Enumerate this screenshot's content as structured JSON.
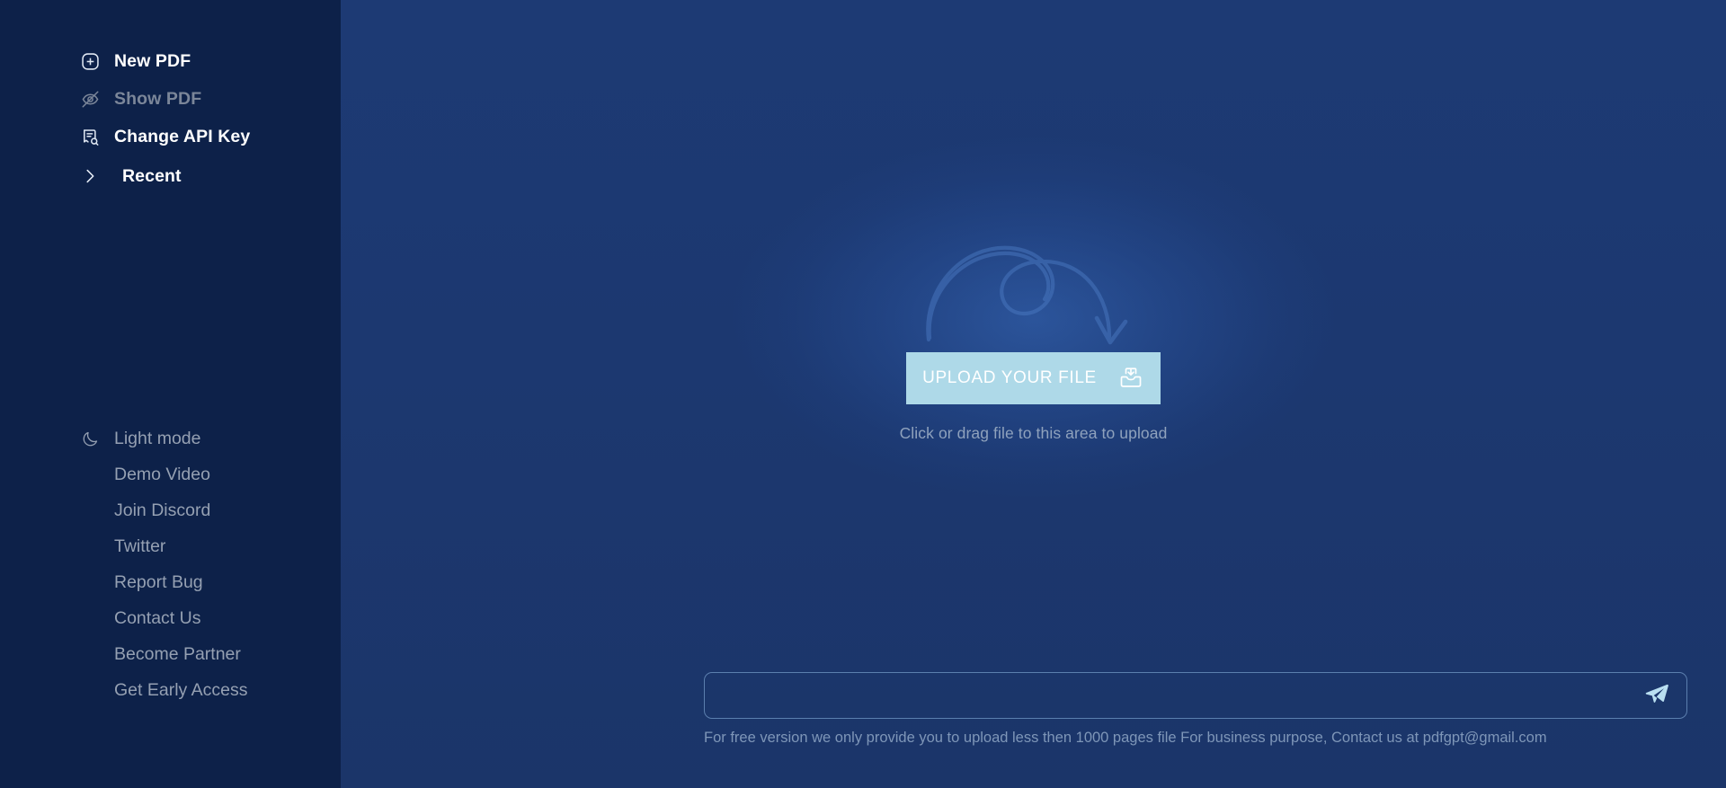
{
  "app": {
    "accent_button_bg": "#aed9e8",
    "sidebar_bg": "#0d2149",
    "main_bg": "#1c3870",
    "muted_text": "#95a0b2"
  },
  "sidebar": {
    "primary_items": [
      {
        "label": "New PDF",
        "icon": "plus-square-icon",
        "state": "active"
      },
      {
        "label": "Show PDF",
        "icon": "eye-off-icon",
        "state": "disabled"
      },
      {
        "label": "Change API Key",
        "icon": "document-search-icon",
        "state": "active"
      },
      {
        "label": "Recent",
        "icon": "chevron-right-icon",
        "state": "active"
      }
    ],
    "secondary_items": [
      {
        "label": "Light mode",
        "icon": "moon-icon"
      },
      {
        "label": "Demo Video",
        "icon": ""
      },
      {
        "label": "Join Discord",
        "icon": ""
      },
      {
        "label": "Twitter",
        "icon": ""
      },
      {
        "label": "Report Bug",
        "icon": ""
      },
      {
        "label": "Contact Us",
        "icon": ""
      },
      {
        "label": "Become Partner",
        "icon": ""
      },
      {
        "label": "Get Early Access",
        "icon": ""
      }
    ]
  },
  "main": {
    "dropzone": {
      "upload_button_label": "UPLOAD YOUR FILE",
      "upload_button_icon": "inbox-download-icon",
      "hint": "Click or drag file to this area to upload",
      "decoration_icon": "curved-looping-arrow"
    },
    "composer": {
      "value": "",
      "placeholder": "",
      "send_icon": "send-paper-plane-icon"
    },
    "footer_note": "For free version we only provide you to upload less then 1000 pages file For business purpose, Contact us at pdfgpt@gmail.com"
  }
}
